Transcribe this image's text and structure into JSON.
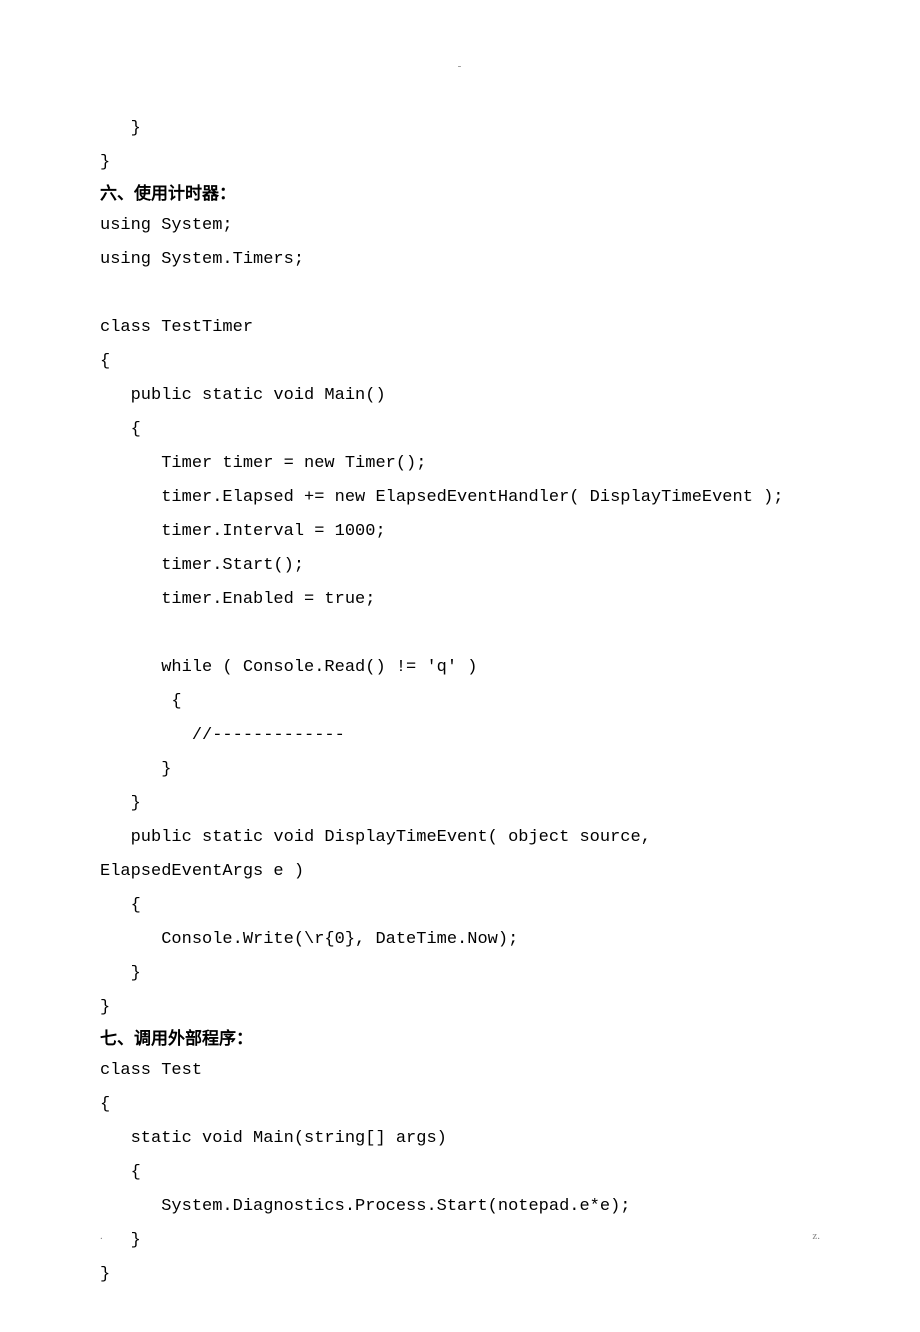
{
  "header": {
    "mark": "-"
  },
  "lines": [
    {
      "type": "code",
      "text": "   }"
    },
    {
      "type": "code",
      "text": "}"
    },
    {
      "type": "heading",
      "text": "六、使用计时器："
    },
    {
      "type": "code",
      "text": "using System;"
    },
    {
      "type": "code",
      "text": "using System.Timers;"
    },
    {
      "type": "code",
      "text": ""
    },
    {
      "type": "code",
      "text": "class TestTimer"
    },
    {
      "type": "code",
      "text": "{"
    },
    {
      "type": "code",
      "text": "   public static void Main()"
    },
    {
      "type": "code",
      "text": "   {"
    },
    {
      "type": "code",
      "text": "      Timer timer = new Timer();"
    },
    {
      "type": "code",
      "text": "      timer.Elapsed += new ElapsedEventHandler( DisplayTimeEvent );"
    },
    {
      "type": "code",
      "text": "      timer.Interval = 1000;"
    },
    {
      "type": "code",
      "text": "      timer.Start();"
    },
    {
      "type": "code",
      "text": "      timer.Enabled = true;"
    },
    {
      "type": "code",
      "text": ""
    },
    {
      "type": "code",
      "text": "      while ( Console.Read() != 'q' )"
    },
    {
      "type": "code",
      "text": "       {"
    },
    {
      "type": "code",
      "text": "         //-------------"
    },
    {
      "type": "code",
      "text": "      }"
    },
    {
      "type": "code",
      "text": "   }"
    },
    {
      "type": "code",
      "text": "   public static void DisplayTimeEvent( object source,"
    },
    {
      "type": "code",
      "text": "ElapsedEventArgs e )"
    },
    {
      "type": "code",
      "text": "   {"
    },
    {
      "type": "code",
      "text": "      Console.Write(\\r{0}, DateTime.Now);"
    },
    {
      "type": "code",
      "text": "   }"
    },
    {
      "type": "code",
      "text": "}"
    },
    {
      "type": "heading",
      "text": "七、调用外部程序："
    },
    {
      "type": "code",
      "text": "class Test"
    },
    {
      "type": "code",
      "text": "{"
    },
    {
      "type": "code",
      "text": "   static void Main(string[] args)"
    },
    {
      "type": "code",
      "text": "   {"
    },
    {
      "type": "code",
      "text": "      System.Diagnostics.Process.Start(notepad.e*e);"
    },
    {
      "type": "code",
      "text": "   }"
    },
    {
      "type": "code",
      "text": "}"
    }
  ],
  "footer": {
    "left": ".",
    "right": "z."
  }
}
